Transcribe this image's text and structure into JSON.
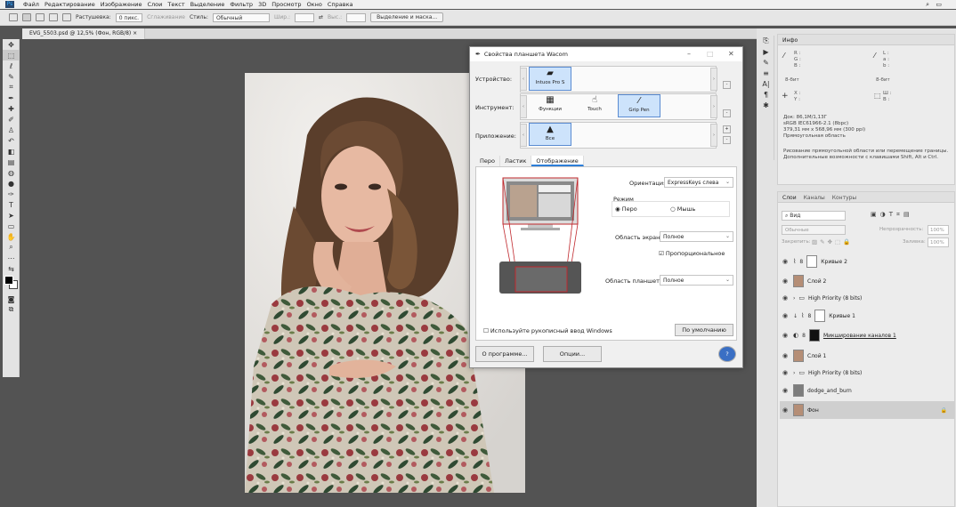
{
  "menubar": {
    "items": [
      "Файл",
      "Редактирование",
      "Изображение",
      "Слои",
      "Текст",
      "Выделение",
      "Фильтр",
      "3D",
      "Просмотр",
      "Окно",
      "Справка"
    ]
  },
  "optbar": {
    "feather_label": "Растушевка:",
    "feather_value": "0 пикс.",
    "antialias_label": "Сглаживание",
    "style_label": "Стиль:",
    "style_value": "Обычный",
    "width_label": "Шир.:",
    "height_label": "Выс.:",
    "select_mask_button": "Выделение и маска..."
  },
  "document": {
    "tab_title": "EVG_5503.psd @ 12,5% (Фон, RGB/8) ×"
  },
  "info_panel": {
    "tab": "Инфо",
    "r_label": "R :",
    "g_label": "G :",
    "b_label": "B :",
    "l_label": "L :",
    "a_label": "a :",
    "b2_label": "b :",
    "bit_left": "8-бит",
    "bit_right": "8-бит",
    "x_label": "X :",
    "y_label": "Y :",
    "w_label": "Ш :",
    "h_label": "В :",
    "doc_line1": "Док: 86,1М/1,13Г",
    "doc_line2": "sRGB IEC61966-2.1 (8bpc)",
    "doc_line3": "379,31 мм x 568,96 мм (300 ppi)",
    "doc_line4": "Прямоугольная область",
    "hint_line1": "Рисование прямоугольной области или перемещение границы.",
    "hint_line2": "Дополнительные возможности с клавишами Shift, Alt и Ctrl."
  },
  "layers_panel": {
    "tabs": [
      "Слои",
      "Каналы",
      "Контуры"
    ],
    "filter_value": "Вид",
    "blend_mode": "Обычные",
    "opacity_label": "Непрозрачность:",
    "opacity_value": "100%",
    "lock_label": "Закрепить:",
    "fill_label": "Заливка:",
    "fill_value": "100%",
    "layers": [
      {
        "name": "Кривые 2"
      },
      {
        "name": "Слой 2"
      },
      {
        "name": "High Priority (8 bits)"
      },
      {
        "name": "Кривые 1"
      },
      {
        "name": "Микширование каналов 1"
      },
      {
        "name": "Слой 1"
      },
      {
        "name": "High Priority (8 bits)"
      },
      {
        "name": "dodge_and_burn"
      },
      {
        "name": "Фон"
      }
    ]
  },
  "wacom": {
    "title": "Свойства планшета Wacom",
    "device_label": "Устройство:",
    "device_item": "Intuos Pro S",
    "tool_label": "Инструмент:",
    "tool_items": [
      "Функции",
      "Touch",
      "Grip Pen"
    ],
    "app_label": "Приложение:",
    "app_item": "Все",
    "tabs": [
      "Перо",
      "Ластик",
      "Отображение"
    ],
    "orientation_label": "Ориентация:",
    "orientation_value": "ExpressKeys слева",
    "mode_label": "Режим",
    "mode_pen": "Перо",
    "mode_mouse": "Мышь",
    "screen_area_label": "Область экрана:",
    "screen_area_value": "Полное",
    "proportional_label": "Пропорциональное",
    "tablet_area_label": "Область планшета:",
    "tablet_area_value": "Полное",
    "windows_ink_label": "Используйте рукописный ввод Windows",
    "default_button": "По умолчанию",
    "about_button": "О программе...",
    "options_button": "Опции...",
    "help_button": "?"
  }
}
